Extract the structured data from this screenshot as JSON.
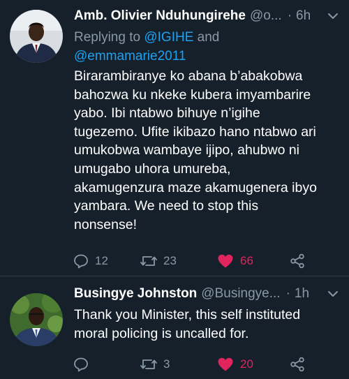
{
  "tweets": [
    {
      "name": "Amb. Olivier Nduhungirehe",
      "handle": "@o...",
      "time": "6h",
      "reply_prefix": "Replying to",
      "reply_mention_1": "@IGIHE",
      "reply_and": "and",
      "reply_mention_2": "@emmamarie2011",
      "lines": [
        "Birarambiranye ko abana b’abakobwa",
        "bahozwa ku nkeke kubera imyambarire",
        "yabo. Ibi ntabwo bihuye n’igihe",
        "tugezemo. Ufite ikibazo hano ntabwo ari",
        "umukobwa wambaye ijipo, ahubwo ni",
        "umugabo uhora umureba,",
        "akamugenzura maze akamugenera ibyo",
        "yambara. We need to stop this",
        "nonsense!"
      ],
      "replies": "12",
      "retweets": "23",
      "likes": "66"
    },
    {
      "name": "Busingye Johnston",
      "handle": "@Busingye...",
      "time": "1h",
      "lines": [
        "Thank you Minister, this self instituted",
        "moral policing is uncalled for."
      ],
      "replies": "",
      "retweets": "3",
      "likes": "20"
    }
  ],
  "colors": {
    "background": "#15202b",
    "secondary_text": "#8899a6",
    "link": "#1da1f2",
    "like": "#e0245e"
  },
  "icons": [
    "reply-icon",
    "retweet-icon",
    "heart-filled-icon",
    "share-icon",
    "chevron-down-icon"
  ]
}
